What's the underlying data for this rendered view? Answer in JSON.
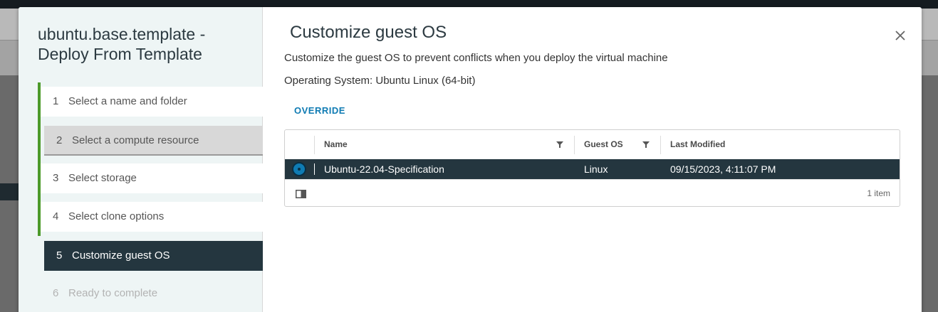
{
  "wizard": {
    "title_line1": "ubuntu.base.template -",
    "title_line2": "Deploy From Template",
    "steps": [
      {
        "num": "1",
        "label": "Select a name and folder"
      },
      {
        "num": "2",
        "label": "Select a compute resource"
      },
      {
        "num": "3",
        "label": "Select storage"
      },
      {
        "num": "4",
        "label": "Select clone options"
      },
      {
        "num": "5",
        "label": "Customize guest OS"
      },
      {
        "num": "6",
        "label": "Ready to complete"
      }
    ],
    "active_step": "5"
  },
  "page": {
    "title": "Customize guest OS",
    "description": "Customize the guest OS to prevent conflicts when you deploy the virtual machine",
    "os_line": "Operating System: Ubuntu Linux (64-bit)",
    "override_label": "OVERRIDE"
  },
  "grid": {
    "columns": [
      "Name",
      "Guest OS",
      "Last Modified"
    ],
    "rows": [
      {
        "name": "Ubuntu-22.04-Specification",
        "guest_os": "Linux",
        "last_modified": "09/15/2023, 4:11:07 PM",
        "selected": true
      }
    ],
    "footer_count": "1 item"
  },
  "icons": {
    "close": "close-icon",
    "filter": "filter-icon",
    "column_toggle": "column-toggle-icon",
    "radio": "radio-selected-icon"
  },
  "colors": {
    "accent_blue": "#0f7bb3",
    "active_dark": "#24363f",
    "progress_green": "#4c9a2a"
  }
}
